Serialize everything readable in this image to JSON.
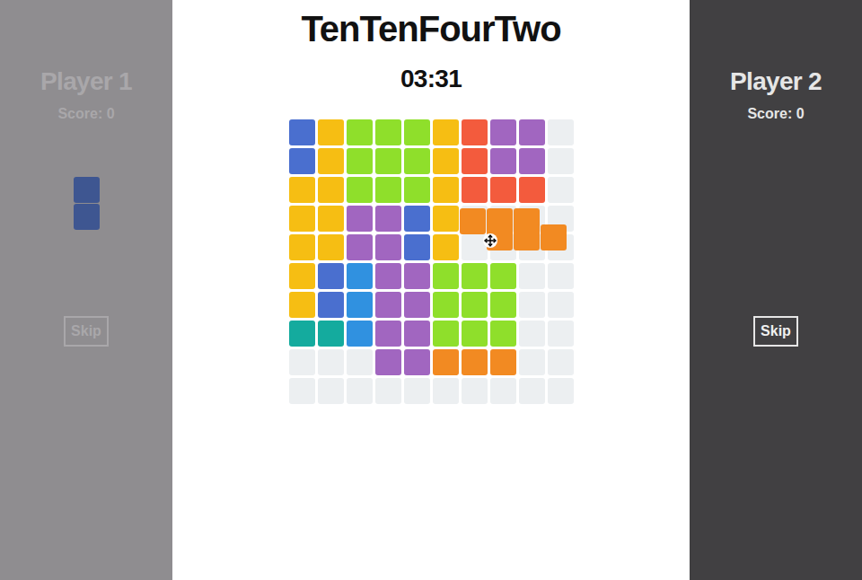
{
  "title": "TenTenFourTwo",
  "timer": "03:31",
  "players": [
    {
      "name": "Player 1",
      "score": "Score: 0",
      "active": false,
      "skip": "Skip",
      "piece": {
        "color": "#3e5691",
        "cells": [
          {
            "row": 0,
            "col": 0
          },
          {
            "row": 1,
            "col": 0
          }
        ]
      }
    },
    {
      "name": "Player 2",
      "score": "Score: 0",
      "active": true,
      "skip": "Skip",
      "piece": {
        "color": "#3e5691",
        "cells": []
      }
    }
  ],
  "board": {
    "empty": "#eceff1",
    "rows": [
      [
        "#4a6fcf",
        "#f6be13",
        "#8fdf2b",
        "#8fdf2b",
        "#8fdf2b",
        "#f6be13",
        "#f35b3d",
        "#a166c0",
        "#a166c0",
        null
      ],
      [
        "#4a6fcf",
        "#f6be13",
        "#8fdf2b",
        "#8fdf2b",
        "#8fdf2b",
        "#f6be13",
        "#f35b3d",
        "#a166c0",
        "#a166c0",
        null
      ],
      [
        "#f6be13",
        "#f6be13",
        "#8fdf2b",
        "#8fdf2b",
        "#8fdf2b",
        "#f6be13",
        "#f35b3d",
        "#f35b3d",
        "#f35b3d",
        null
      ],
      [
        "#f6be13",
        "#f6be13",
        "#a166c0",
        "#a166c0",
        "#4a6fcf",
        "#f6be13",
        null,
        null,
        null,
        null
      ],
      [
        "#f6be13",
        "#f6be13",
        "#a166c0",
        "#a166c0",
        "#4a6fcf",
        "#f6be13",
        null,
        null,
        null,
        null
      ],
      [
        "#f6be13",
        "#4a6fcf",
        "#3091e0",
        "#a166c0",
        "#a166c0",
        "#8fdf2b",
        "#8fdf2b",
        "#8fdf2b",
        null,
        null
      ],
      [
        "#f6be13",
        "#4a6fcf",
        "#3091e0",
        "#a166c0",
        "#a166c0",
        "#8fdf2b",
        "#8fdf2b",
        "#8fdf2b",
        null,
        null
      ],
      [
        "#14ab9e",
        "#14ab9e",
        "#3091e0",
        "#a166c0",
        "#a166c0",
        "#8fdf2b",
        "#8fdf2b",
        "#8fdf2b",
        null,
        null
      ],
      [
        null,
        null,
        null,
        "#a166c0",
        "#a166c0",
        "#f28a22",
        "#f28a22",
        "#f28a22",
        null,
        null
      ],
      [
        null,
        null,
        null,
        null,
        null,
        null,
        null,
        null,
        null,
        null
      ]
    ]
  },
  "dragging": {
    "color": "#f28a22",
    "cells": [
      {
        "row": 0,
        "col": 0
      },
      {
        "row": 0,
        "col": 1
      },
      {
        "row": 0,
        "col": 2
      },
      {
        "row": 1,
        "col": 1
      },
      {
        "row": 1,
        "col": 2
      },
      {
        "row": 1,
        "col": 3
      }
    ]
  }
}
